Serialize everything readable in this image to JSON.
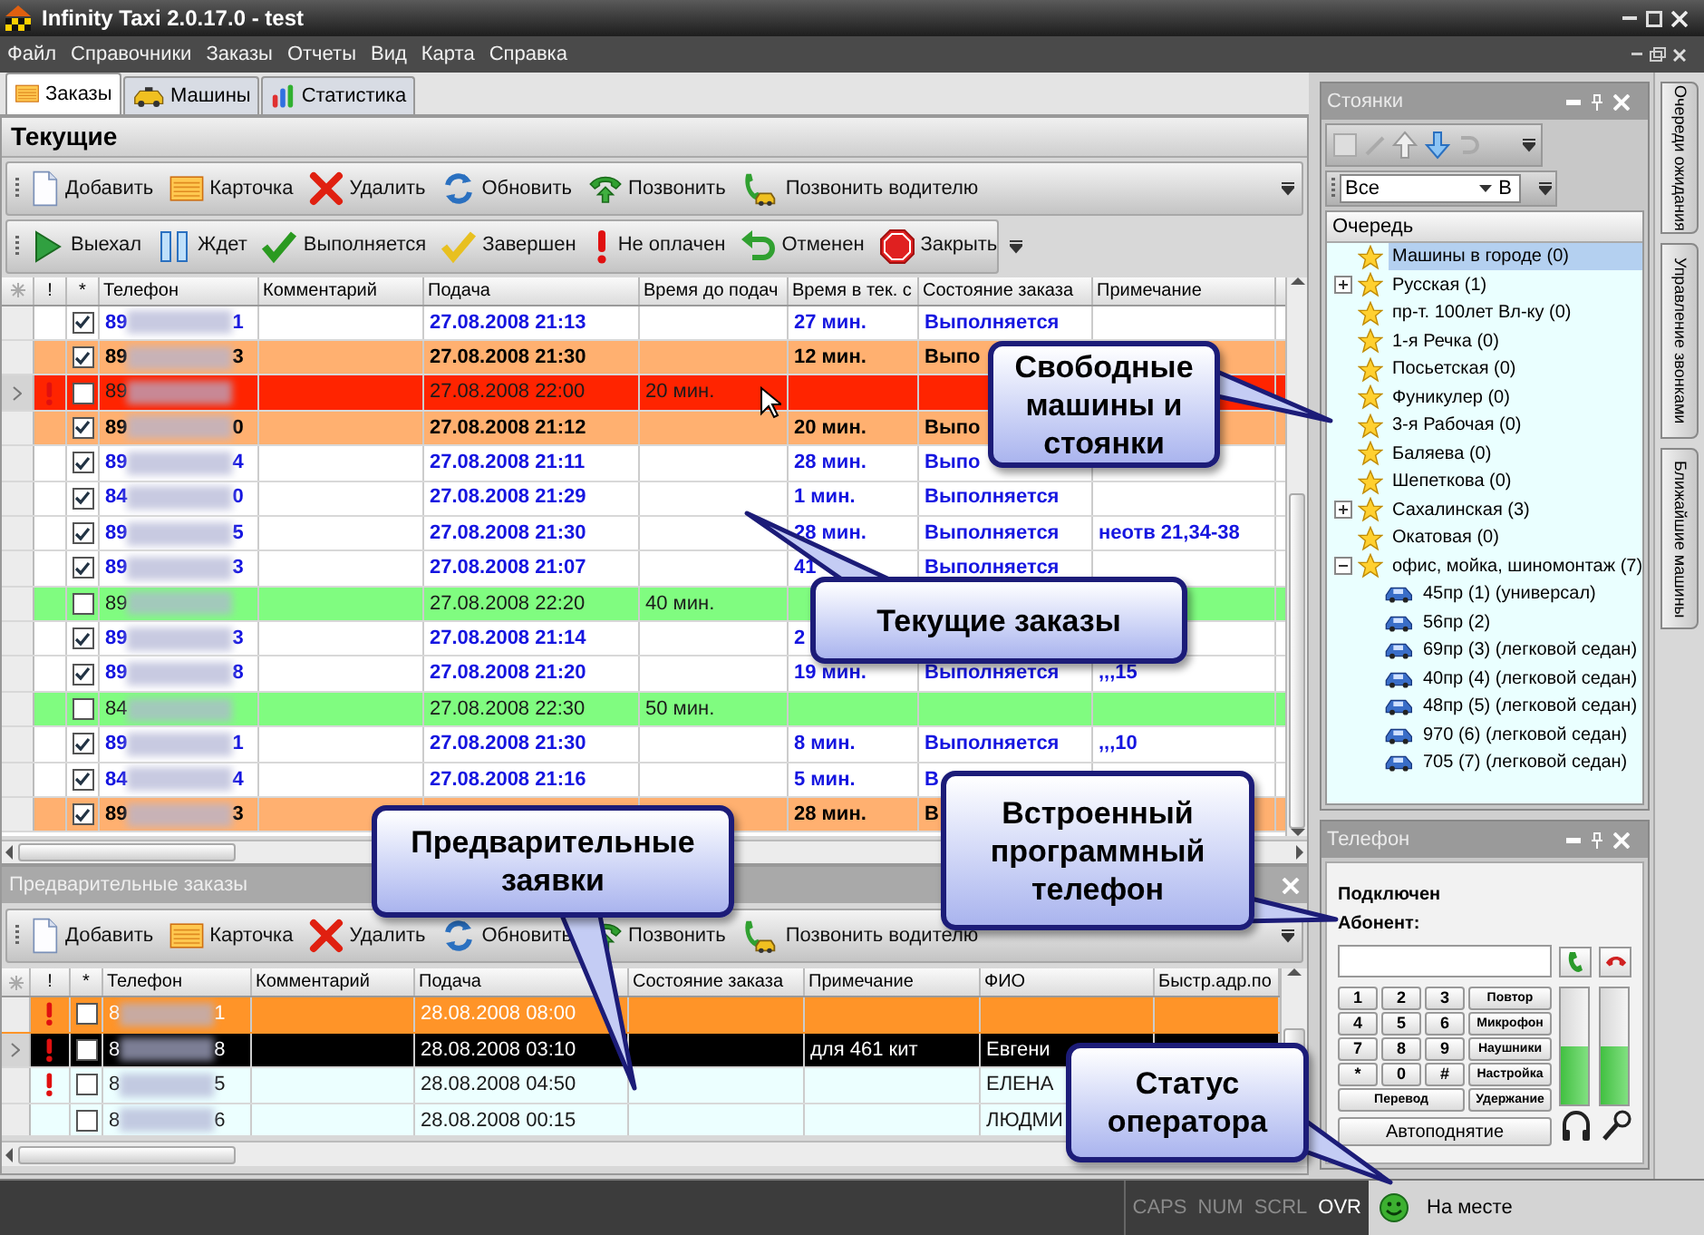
{
  "window": {
    "title": "Infinity Taxi 2.0.17.0 - test"
  },
  "menu": [
    "Файл",
    "Справочники",
    "Заказы",
    "Отчеты",
    "Вид",
    "Карта",
    "Справка"
  ],
  "tabs": [
    {
      "label": "Заказы",
      "selected": true
    },
    {
      "label": "Машины",
      "selected": false
    },
    {
      "label": "Статистика",
      "selected": false
    }
  ],
  "current": {
    "title": "Текущие",
    "toolbar": [
      "Добавить",
      "Карточка",
      "Удалить",
      "Обновить",
      "Позвонить",
      "Позвонить водителю"
    ],
    "status_toolbar": [
      "Выехал",
      "Ждет",
      "Выполняется",
      "Завершен",
      "Не оплачен",
      "Отменен",
      "Закрыть"
    ],
    "columns": [
      "!",
      "*",
      "Телефон",
      "Комментарий",
      "Подача",
      "Время до подач",
      "Время в тек. с",
      "Состояние заказа",
      "Примечание"
    ],
    "rows": [
      {
        "kind": "active",
        "selected": false,
        "alert": false,
        "checked": true,
        "phone_start": "89",
        "phone_end": "1",
        "pickup": "27.08.2008 21:13",
        "time_in": "27 мин.",
        "state": "Выполняется"
      },
      {
        "kind": "urgent",
        "selected": false,
        "alert": false,
        "checked": true,
        "phone_start": "89",
        "phone_end": "3",
        "pickup": "27.08.2008 21:30",
        "time_in": "12 мин.",
        "state": "Выпо"
      },
      {
        "kind": "overdue",
        "selected": true,
        "alert": true,
        "checked": false,
        "phone_start": "89",
        "pickup": "27.08.2008 22:00",
        "time_to": "20 мин."
      },
      {
        "kind": "urgent",
        "selected": false,
        "alert": false,
        "checked": true,
        "phone_start": "89",
        "phone_end": "0",
        "pickup": "27.08.2008 21:12",
        "time_in": "20 мин.",
        "state": "Выпо"
      },
      {
        "kind": "active",
        "selected": false,
        "alert": false,
        "checked": true,
        "phone_start": "89",
        "phone_end": "4",
        "pickup": "27.08.2008 21:11",
        "time_in": "28 мин.",
        "state": "Выпо"
      },
      {
        "kind": "active",
        "selected": false,
        "alert": false,
        "checked": true,
        "phone_start": "84",
        "phone_end": "0",
        "pickup": "27.08.2008 21:29",
        "time_in": "1 мин.",
        "state": "Выполняется"
      },
      {
        "kind": "active",
        "selected": false,
        "alert": false,
        "checked": true,
        "phone_start": "89",
        "phone_end": "5",
        "pickup": "27.08.2008 21:30",
        "time_in": "28 мин.",
        "state": "Выполняется",
        "note": "неотв 21,34-38"
      },
      {
        "kind": "active",
        "selected": false,
        "alert": false,
        "checked": true,
        "phone_start": "89",
        "phone_end": "3",
        "pickup": "27.08.2008 21:07",
        "time_in": "41",
        "state": "Выполняется"
      },
      {
        "kind": "scheduled",
        "selected": false,
        "alert": false,
        "checked": false,
        "phone_start": "89",
        "pickup": "27.08.2008 22:20",
        "time_to": "40 мин."
      },
      {
        "kind": "active",
        "selected": false,
        "alert": false,
        "checked": true,
        "phone_start": "89",
        "phone_end": "3",
        "pickup": "27.08.2008 21:14",
        "time_in": "2"
      },
      {
        "kind": "active",
        "selected": false,
        "alert": false,
        "checked": true,
        "phone_start": "89",
        "phone_end": "8",
        "pickup": "27.08.2008 21:20",
        "time_in": "19 мин.",
        "state": "Выполняется",
        "note": ",,,15"
      },
      {
        "kind": "scheduled",
        "selected": false,
        "alert": false,
        "checked": false,
        "phone_start": "84",
        "pickup": "27.08.2008 22:30",
        "time_to": "50 мин."
      },
      {
        "kind": "active",
        "selected": false,
        "alert": false,
        "checked": true,
        "phone_start": "89",
        "phone_end": "1",
        "pickup": "27.08.2008 21:30",
        "time_in": "8 мин.",
        "state": "Выполняется",
        "note": ",,,10"
      },
      {
        "kind": "active",
        "selected": false,
        "alert": false,
        "checked": true,
        "phone_start": "84",
        "phone_end": "4",
        "pickup": "27.08.2008 21:16",
        "time_in": "5 мин.",
        "state": "В"
      },
      {
        "kind": "urgent",
        "selected": false,
        "alert": false,
        "checked": true,
        "phone_start": "89",
        "phone_end": "3",
        "time_in": "28 мин.",
        "state": "В"
      }
    ]
  },
  "preliminary": {
    "title": "Предварительные заказы",
    "toolbar": [
      "Добавить",
      "Карточка",
      "Удалить",
      "Обновить",
      "Позвонить",
      "Позвонить водителю"
    ],
    "columns": [
      "!",
      "*",
      "Телефон",
      "Комментарий",
      "Подача",
      "Состояние заказа",
      "Примечание",
      "ФИО",
      "Быстр.адр.по"
    ],
    "rows": [
      {
        "kind": "urgent",
        "selected": false,
        "alert": true,
        "checked": false,
        "phone_start": "8",
        "phone_end": "1",
        "pickup": "28.08.2008 08:00"
      },
      {
        "kind": "pending",
        "selected": true,
        "alert": true,
        "checked": false,
        "phone_start": "8",
        "phone_end": "8",
        "pickup": "28.08.2008 03:10",
        "note": "для 461  кит",
        "fio": "Евгени"
      },
      {
        "kind": "pending",
        "selected": false,
        "alert": true,
        "checked": false,
        "phone_start": "8",
        "phone_end": "5",
        "pickup": "28.08.2008 04:50",
        "fio": "ЕЛЕНА"
      },
      {
        "kind": "pending",
        "selected": false,
        "alert": false,
        "checked": false,
        "phone_start": "8",
        "phone_end": "6",
        "pickup": "28.08.2008 00:15",
        "fio": "ЛЮДМИ"
      }
    ]
  },
  "stands": {
    "title": "Стоянки",
    "filter": "Все",
    "filter_suffix": "В",
    "column": "Очередь",
    "items": [
      {
        "label": "Машины в городе  (0)",
        "selected": true
      },
      {
        "label": "Русская  (1)",
        "expanded": false,
        "selected": false
      },
      {
        "label": "пр-т. 100лет Вл-ку  (0)",
        "selected": false
      },
      {
        "label": "1-я Речка  (0)",
        "selected": false
      },
      {
        "label": "Посьетская  (0)",
        "selected": false
      },
      {
        "label": "Фуникулер  (0)",
        "selected": false
      },
      {
        "label": "3-я Рабочая  (0)",
        "selected": false
      },
      {
        "label": "Баляева  (0)",
        "selected": false
      },
      {
        "label": "Шепеткова  (0)",
        "selected": false
      },
      {
        "label": "Сахалинская  (3)",
        "expanded": false,
        "selected": false
      },
      {
        "label": "Окатовая  (0)",
        "selected": false
      },
      {
        "label": "офис, мойка, шиномонтаж  (7)",
        "expanded": true,
        "selected": false,
        "children": [
          {
            "label": "45пр  (1) (универсал)",
            "selected": false
          },
          {
            "label": "56пр  (2)",
            "selected": false
          },
          {
            "label": "69пр  (3) (легковой седан)",
            "selected": false
          },
          {
            "label": "40пр  (4) (легковой седан)",
            "selected": false
          },
          {
            "label": "48пр  (5) (легковой седан)",
            "selected": false
          },
          {
            "label": "970  (6) (легковой седан)",
            "selected": false
          },
          {
            "label": "705  (7) (легковой седан)",
            "selected": false
          }
        ]
      }
    ]
  },
  "phone": {
    "title": "Телефон",
    "status": "Подключен",
    "subscriber_label": "Абонент:",
    "keys": [
      "1",
      "2",
      "3",
      "4",
      "5",
      "6",
      "7",
      "8",
      "9",
      "*",
      "0",
      "#"
    ],
    "side_buttons": [
      "Повтор",
      "Микрофон",
      "Наушники",
      "Настройка"
    ],
    "transfer": "Перевод",
    "hold": "Удержание",
    "autoanswer": "Автоподнятие",
    "meters": [
      {
        "level": 0.5
      },
      {
        "level": 0.5
      }
    ]
  },
  "side_tabs": [
    "Очереди ожидания",
    "Управление звонками",
    "Ближайшие машины"
  ],
  "status_bar": {
    "keys": [
      {
        "label": "CAPS",
        "on": false
      },
      {
        "label": "NUM",
        "on": false
      },
      {
        "label": "SCRL",
        "on": false
      },
      {
        "label": "OVR",
        "on": true
      }
    ],
    "operator_status": "На месте"
  },
  "callouts": [
    {
      "text": "Свободные машины и стоянки"
    },
    {
      "text": "Текущие заказы"
    },
    {
      "text": "Предварительные заявки"
    },
    {
      "text": "Встроенный программный телефон"
    },
    {
      "text": "Статус оператора"
    }
  ]
}
